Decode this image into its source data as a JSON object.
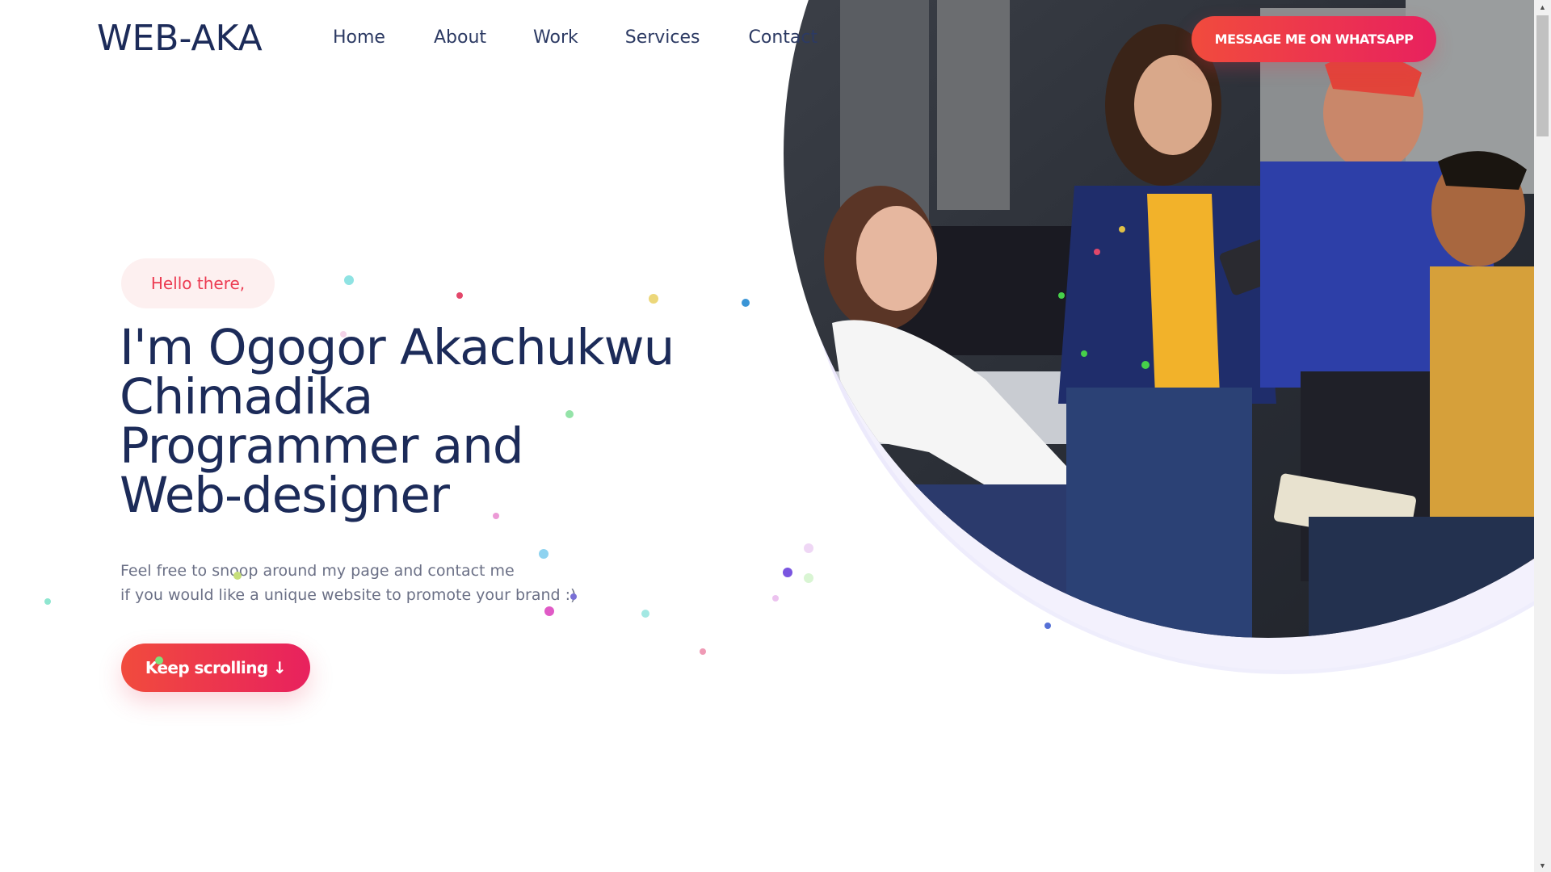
{
  "brand": {
    "logo_text": "WEB-AKA"
  },
  "nav": {
    "items": [
      "Home",
      "About",
      "Work",
      "Services",
      "Contact"
    ]
  },
  "header": {
    "whatsapp_button": "MESSAGE ME ON WHATSAPP"
  },
  "hero": {
    "greeting": "Hello there,",
    "headline_lines": [
      "I'm Ogogor Akachukwu",
      "Chimadika",
      "Programmer and",
      "Web-designer"
    ],
    "intro_lines": [
      "Feel free to snoop around my page and contact me",
      "if you would like a unique website to promote your brand :)"
    ],
    "scroll_button": "Keep scrolling ↓",
    "image_icon": "team-photo-icon"
  },
  "colors": {
    "accent_start": "#f14b3d",
    "accent_end": "#e8215e",
    "navy": "#1c2b59",
    "greeting_bg": "#fdf0f0",
    "muted_text": "#6b7086"
  }
}
